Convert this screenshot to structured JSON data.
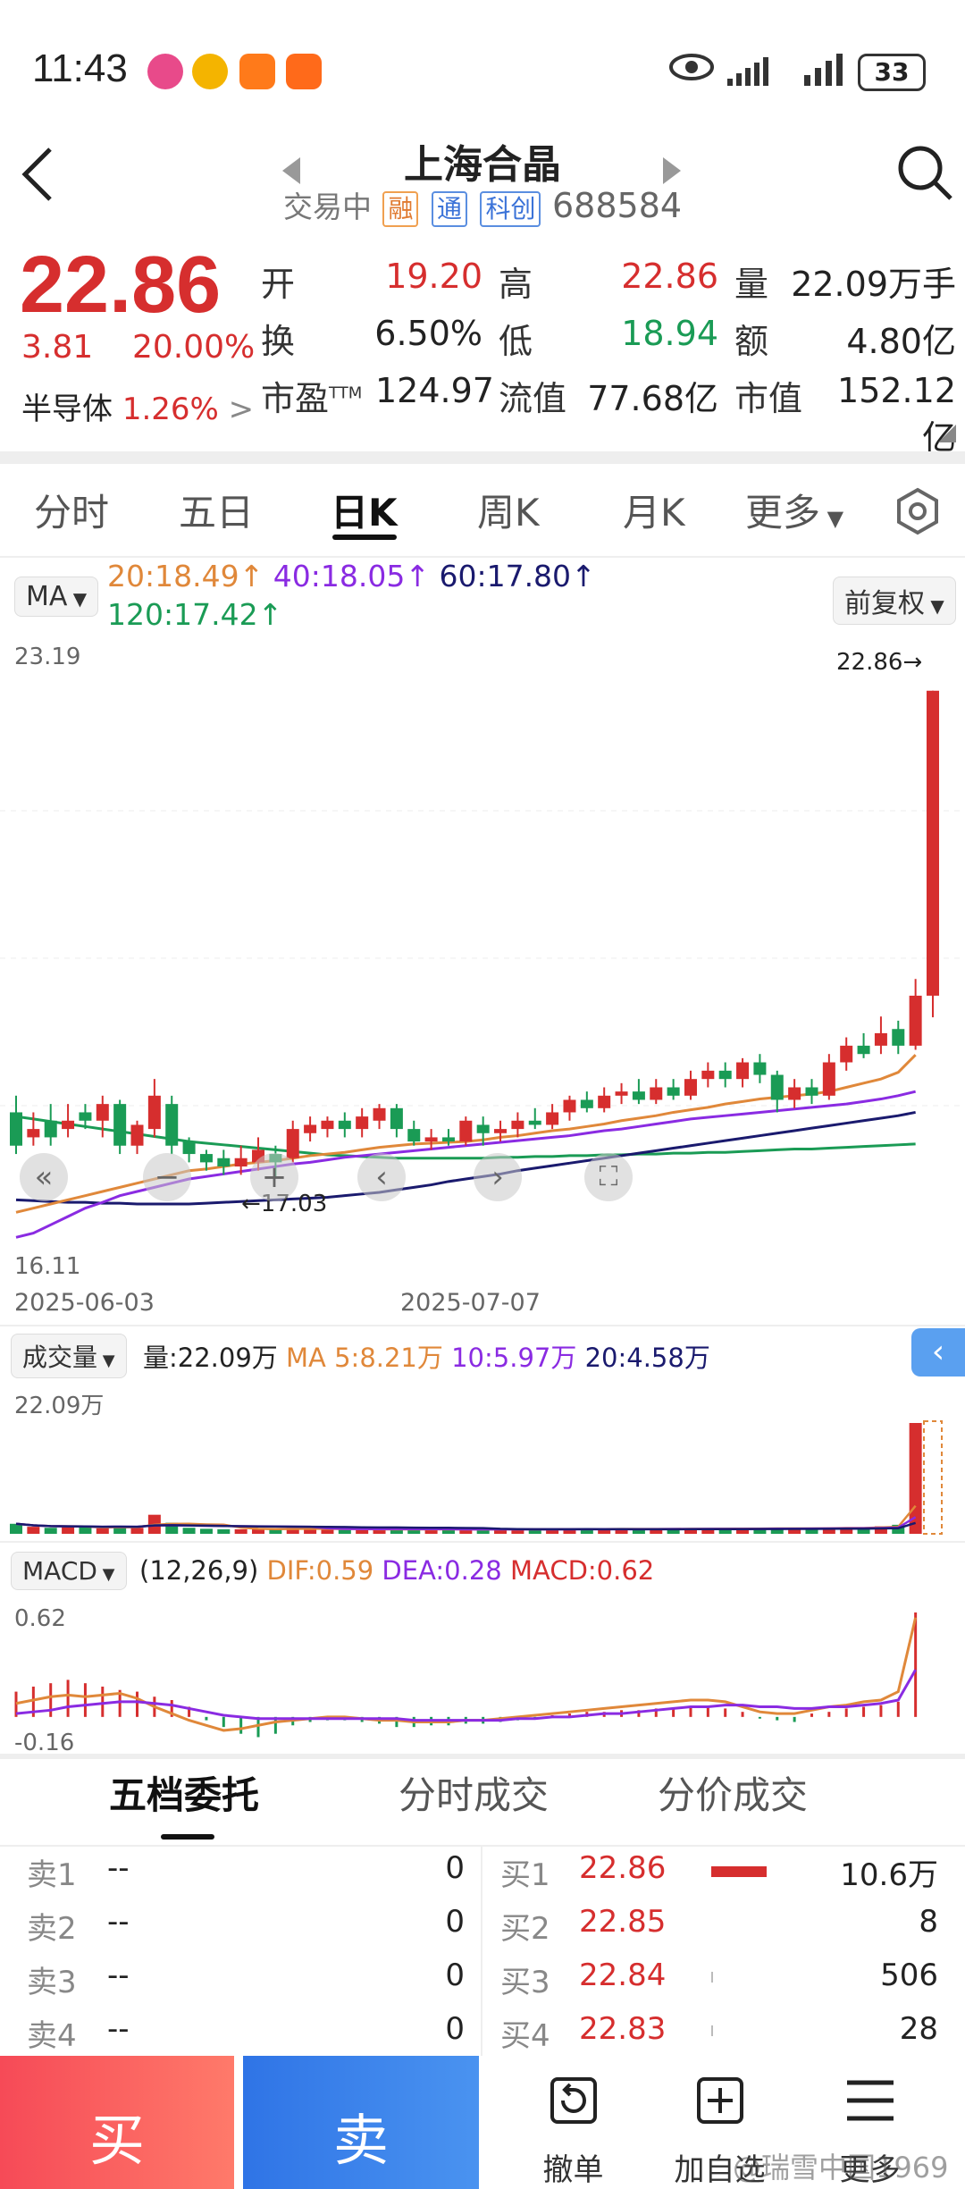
{
  "status": {
    "time": "11:43",
    "battery": "33"
  },
  "header": {
    "name": "上海合晶",
    "trade_status": "交易中",
    "tags": [
      "融",
      "通",
      "科创"
    ],
    "code": "688584"
  },
  "price": {
    "last": "22.86",
    "change": "3.81",
    "change_pct": "20.00%",
    "sector": "半导体",
    "sector_pct": "1.26%"
  },
  "quote": {
    "open_label": "开",
    "open": "19.20",
    "high_label": "高",
    "high": "22.86",
    "vol_label": "量",
    "vol": "22.09万手",
    "turnover_label": "换",
    "turnover": "6.50%",
    "low_label": "低",
    "low": "18.94",
    "amount_label": "额",
    "amount": "4.80亿",
    "pe_label": "市盈",
    "pe_sup": "TTM",
    "pe": "124.97",
    "float_label": "流值",
    "float_cap": "77.68亿",
    "mcap_label": "市值",
    "mcap": "152.12亿"
  },
  "tabs": [
    "分时",
    "五日",
    "日K",
    "周K",
    "月K",
    "更多"
  ],
  "ma": {
    "chip": "MA",
    "ma20": "20:18.49",
    "ma40": "40:18.05",
    "ma60": "60:17.80",
    "ma120": "120:17.42",
    "adjust": "前复权"
  },
  "kline": {
    "top_label": "23.19",
    "bottom_label": "16.11",
    "max_label": "22.86",
    "min_label": "17.03",
    "date_start": "2025-06-03",
    "date_mid": "2025-07-07"
  },
  "volume": {
    "chip": "成交量",
    "vol": "量:22.09万",
    "ma5": "MA 5:8.21万",
    "ma10": "10:5.97万",
    "ma20": "20:4.58万",
    "top_label": "22.09万"
  },
  "macd": {
    "chip": "MACD",
    "params": "(12,26,9)",
    "dif": "DIF:0.59",
    "dea": "DEA:0.28",
    "macd": "MACD:0.62",
    "top_label": "0.62",
    "bottom_label": "-0.16"
  },
  "bottom_tabs": [
    "五档委托",
    "分时成交",
    "分价成交"
  ],
  "sell_orders": [
    {
      "label": "卖1",
      "price": "--",
      "qty": "0"
    },
    {
      "label": "卖2",
      "price": "--",
      "qty": "0"
    },
    {
      "label": "卖3",
      "price": "--",
      "qty": "0"
    },
    {
      "label": "卖4",
      "price": "--",
      "qty": "0"
    }
  ],
  "buy_orders": [
    {
      "label": "买1",
      "price": "22.86",
      "qty": "10.6万"
    },
    {
      "label": "买2",
      "price": "22.85",
      "qty": "8"
    },
    {
      "label": "买3",
      "price": "22.84",
      "qty": "506"
    },
    {
      "label": "买4",
      "price": "22.83",
      "qty": "28"
    }
  ],
  "actions": {
    "buy": "买",
    "sell": "卖",
    "cancel": "撤单",
    "watch": "加自选",
    "more": "更多"
  },
  "watermark": "@瑞雪中国1969",
  "colors": {
    "up": "#d62e2e",
    "down": "#1a9b55",
    "ma20": "#e0883a",
    "ma40": "#8a2be2",
    "ma60": "#1a1a6e",
    "ma120": "#1a9b55"
  },
  "chart_data": {
    "type": "candlestick",
    "y_range": [
      16.11,
      23.19
    ],
    "candles": [
      {
        "o": 17.8,
        "c": 17.4,
        "h": 18.0,
        "l": 17.3
      },
      {
        "o": 17.5,
        "c": 17.6,
        "h": 17.8,
        "l": 17.4
      },
      {
        "o": 17.7,
        "c": 17.5,
        "h": 17.9,
        "l": 17.4
      },
      {
        "o": 17.6,
        "c": 17.7,
        "h": 17.9,
        "l": 17.5
      },
      {
        "o": 17.8,
        "c": 17.7,
        "h": 17.9,
        "l": 17.6
      },
      {
        "o": 17.7,
        "c": 17.9,
        "h": 18.0,
        "l": 17.5
      },
      {
        "o": 17.9,
        "c": 17.4,
        "h": 17.95,
        "l": 17.3
      },
      {
        "o": 17.4,
        "c": 17.65,
        "h": 17.7,
        "l": 17.3
      },
      {
        "o": 17.6,
        "c": 18.0,
        "h": 18.2,
        "l": 17.5
      },
      {
        "o": 17.9,
        "c": 17.4,
        "h": 18.0,
        "l": 17.3
      },
      {
        "o": 17.45,
        "c": 17.3,
        "h": 17.5,
        "l": 17.2
      },
      {
        "o": 17.3,
        "c": 17.2,
        "h": 17.35,
        "l": 17.1
      },
      {
        "o": 17.25,
        "c": 17.15,
        "h": 17.35,
        "l": 17.05
      },
      {
        "o": 17.15,
        "c": 17.25,
        "h": 17.4,
        "l": 17.05
      },
      {
        "o": 17.2,
        "c": 17.35,
        "h": 17.5,
        "l": 17.1
      },
      {
        "o": 17.3,
        "c": 17.2,
        "h": 17.4,
        "l": 17.03
      },
      {
        "o": 17.25,
        "c": 17.6,
        "h": 17.7,
        "l": 17.2
      },
      {
        "o": 17.55,
        "c": 17.65,
        "h": 17.75,
        "l": 17.45
      },
      {
        "o": 17.6,
        "c": 17.7,
        "h": 17.75,
        "l": 17.5
      },
      {
        "o": 17.7,
        "c": 17.6,
        "h": 17.8,
        "l": 17.5
      },
      {
        "o": 17.6,
        "c": 17.75,
        "h": 17.85,
        "l": 17.5
      },
      {
        "o": 17.7,
        "c": 17.85,
        "h": 17.9,
        "l": 17.6
      },
      {
        "o": 17.85,
        "c": 17.6,
        "h": 17.9,
        "l": 17.5
      },
      {
        "o": 17.6,
        "c": 17.45,
        "h": 17.7,
        "l": 17.4
      },
      {
        "o": 17.45,
        "c": 17.5,
        "h": 17.6,
        "l": 17.35
      },
      {
        "o": 17.5,
        "c": 17.45,
        "h": 17.6,
        "l": 17.4
      },
      {
        "o": 17.45,
        "c": 17.7,
        "h": 17.75,
        "l": 17.4
      },
      {
        "o": 17.65,
        "c": 17.55,
        "h": 17.75,
        "l": 17.4
      },
      {
        "o": 17.55,
        "c": 17.6,
        "h": 17.7,
        "l": 17.45
      },
      {
        "o": 17.6,
        "c": 17.7,
        "h": 17.8,
        "l": 17.5
      },
      {
        "o": 17.7,
        "c": 17.65,
        "h": 17.85,
        "l": 17.6
      },
      {
        "o": 17.65,
        "c": 17.8,
        "h": 17.9,
        "l": 17.6
      },
      {
        "o": 17.8,
        "c": 17.95,
        "h": 18.0,
        "l": 17.7
      },
      {
        "o": 17.95,
        "c": 17.85,
        "h": 18.05,
        "l": 17.8
      },
      {
        "o": 17.85,
        "c": 18.0,
        "h": 18.1,
        "l": 17.8
      },
      {
        "o": 18.0,
        "c": 18.05,
        "h": 18.15,
        "l": 17.9
      },
      {
        "o": 18.05,
        "c": 17.95,
        "h": 18.2,
        "l": 17.9
      },
      {
        "o": 17.95,
        "c": 18.1,
        "h": 18.2,
        "l": 17.9
      },
      {
        "o": 18.1,
        "c": 18.0,
        "h": 18.2,
        "l": 17.95
      },
      {
        "o": 18.0,
        "c": 18.2,
        "h": 18.3,
        "l": 17.95
      },
      {
        "o": 18.2,
        "c": 18.3,
        "h": 18.4,
        "l": 18.1
      },
      {
        "o": 18.3,
        "c": 18.2,
        "h": 18.4,
        "l": 18.1
      },
      {
        "o": 18.2,
        "c": 18.4,
        "h": 18.45,
        "l": 18.1
      },
      {
        "o": 18.4,
        "c": 18.25,
        "h": 18.5,
        "l": 18.15
      },
      {
        "o": 18.25,
        "c": 17.95,
        "h": 18.3,
        "l": 17.8
      },
      {
        "o": 17.95,
        "c": 18.1,
        "h": 18.2,
        "l": 17.85
      },
      {
        "o": 18.1,
        "c": 18.0,
        "h": 18.2,
        "l": 17.9
      },
      {
        "o": 18.0,
        "c": 18.4,
        "h": 18.5,
        "l": 17.95
      },
      {
        "o": 18.4,
        "c": 18.6,
        "h": 18.7,
        "l": 18.3
      },
      {
        "o": 18.6,
        "c": 18.5,
        "h": 18.75,
        "l": 18.45
      },
      {
        "o": 18.6,
        "c": 18.75,
        "h": 18.95,
        "l": 18.5
      },
      {
        "o": 18.8,
        "c": 18.6,
        "h": 18.9,
        "l": 18.5
      },
      {
        "o": 18.6,
        "c": 19.2,
        "h": 19.4,
        "l": 18.55
      },
      {
        "o": 19.2,
        "c": 22.86,
        "h": 22.86,
        "l": 18.94
      }
    ],
    "ma20_series": [
      16.6,
      16.65,
      16.7,
      16.75,
      16.8,
      16.85,
      16.9,
      16.95,
      17.0,
      17.05,
      17.1,
      17.12,
      17.15,
      17.18,
      17.2,
      17.22,
      17.25,
      17.28,
      17.3,
      17.32,
      17.35,
      17.38,
      17.4,
      17.42,
      17.43,
      17.44,
      17.45,
      17.47,
      17.5,
      17.52,
      17.55,
      17.58,
      17.6,
      17.63,
      17.66,
      17.7,
      17.73,
      17.76,
      17.8,
      17.83,
      17.86,
      17.9,
      17.93,
      17.96,
      17.98,
      18.0,
      18.02,
      18.05,
      18.1,
      18.15,
      18.2,
      18.28,
      18.49
    ],
    "ma40_series": [
      16.3,
      16.35,
      16.45,
      16.55,
      16.65,
      16.72,
      16.8,
      16.85,
      16.9,
      16.95,
      17.0,
      17.03,
      17.06,
      17.09,
      17.12,
      17.15,
      17.18,
      17.2,
      17.23,
      17.26,
      17.28,
      17.3,
      17.32,
      17.34,
      17.36,
      17.38,
      17.4,
      17.42,
      17.44,
      17.46,
      17.48,
      17.5,
      17.52,
      17.55,
      17.58,
      17.6,
      17.63,
      17.66,
      17.69,
      17.72,
      17.74,
      17.76,
      17.78,
      17.8,
      17.82,
      17.84,
      17.86,
      17.88,
      17.9,
      17.93,
      17.96,
      18.0,
      18.05
    ],
    "ma60_series": [
      16.75,
      16.74,
      16.73,
      16.72,
      16.72,
      16.71,
      16.71,
      16.7,
      16.7,
      16.7,
      16.7,
      16.71,
      16.72,
      16.73,
      16.74,
      16.75,
      16.76,
      16.77,
      16.78,
      16.8,
      16.82,
      16.84,
      16.87,
      16.9,
      16.93,
      16.97,
      17.0,
      17.03,
      17.06,
      17.1,
      17.13,
      17.16,
      17.19,
      17.22,
      17.25,
      17.28,
      17.31,
      17.34,
      17.37,
      17.4,
      17.43,
      17.46,
      17.49,
      17.52,
      17.55,
      17.58,
      17.61,
      17.64,
      17.67,
      17.7,
      17.73,
      17.76,
      17.8
    ],
    "ma120_series": [
      17.75,
      17.72,
      17.69,
      17.66,
      17.63,
      17.6,
      17.57,
      17.54,
      17.51,
      17.48,
      17.45,
      17.43,
      17.41,
      17.39,
      17.37,
      17.35,
      17.33,
      17.31,
      17.29,
      17.28,
      17.27,
      17.26,
      17.25,
      17.25,
      17.25,
      17.25,
      17.25,
      17.25,
      17.26,
      17.26,
      17.27,
      17.27,
      17.28,
      17.28,
      17.29,
      17.29,
      17.3,
      17.3,
      17.31,
      17.31,
      17.32,
      17.32,
      17.33,
      17.34,
      17.35,
      17.36,
      17.36,
      17.37,
      17.38,
      17.39,
      17.4,
      17.41,
      17.42
    ],
    "volumes": [
      2.0,
      1.4,
      1.2,
      1.4,
      1.3,
      1.1,
      1.6,
      1.2,
      3.8,
      2.2,
      1.2,
      1.0,
      0.9,
      0.9,
      1.0,
      0.9,
      1.2,
      1.0,
      0.9,
      0.8,
      0.9,
      0.9,
      1.0,
      0.8,
      0.9,
      0.9,
      0.9,
      0.8,
      0.9,
      0.9,
      0.9,
      0.9,
      1.0,
      1.0,
      0.9,
      1.0,
      0.9,
      1.0,
      1.0,
      1.0,
      1.0,
      1.0,
      1.1,
      1.0,
      1.2,
      1.0,
      1.1,
      1.2,
      1.3,
      1.2,
      1.5,
      1.8,
      22.09
    ],
    "macd_bars": [
      0.15,
      0.18,
      0.2,
      0.22,
      0.2,
      0.18,
      0.16,
      0.15,
      0.12,
      0.1,
      0.06,
      -0.02,
      -0.06,
      -0.1,
      -0.12,
      -0.1,
      -0.05,
      -0.03,
      -0.02,
      -0.02,
      -0.03,
      -0.04,
      -0.06,
      -0.06,
      -0.05,
      -0.05,
      -0.04,
      -0.04,
      -0.03,
      -0.02,
      -0.01,
      0.01,
      0.02,
      0.03,
      0.03,
      0.04,
      0.04,
      0.05,
      0.05,
      0.06,
      0.06,
      0.05,
      0.03,
      -0.01,
      -0.02,
      -0.03,
      0.02,
      0.03,
      0.05,
      0.06,
      0.07,
      0.09,
      0.62
    ],
    "dif_series": [
      0.08,
      0.1,
      0.12,
      0.13,
      0.12,
      0.13,
      0.14,
      0.11,
      0.06,
      0.02,
      -0.02,
      -0.05,
      -0.08,
      -0.07,
      -0.05,
      -0.03,
      -0.02,
      -0.01,
      0.0,
      0.0,
      -0.01,
      -0.02,
      -0.02,
      -0.03,
      -0.03,
      -0.03,
      -0.02,
      -0.02,
      -0.01,
      0.0,
      0.01,
      0.02,
      0.03,
      0.04,
      0.05,
      0.06,
      0.07,
      0.08,
      0.09,
      0.1,
      0.1,
      0.09,
      0.06,
      0.03,
      0.02,
      0.02,
      0.04,
      0.06,
      0.07,
      0.09,
      0.1,
      0.15,
      0.59
    ],
    "dea_series": [
      0.02,
      0.03,
      0.04,
      0.06,
      0.07,
      0.08,
      0.09,
      0.09,
      0.08,
      0.07,
      0.05,
      0.03,
      0.01,
      0.0,
      -0.01,
      -0.01,
      -0.01,
      -0.01,
      -0.01,
      -0.01,
      -0.01,
      -0.01,
      -0.01,
      -0.02,
      -0.02,
      -0.02,
      -0.02,
      -0.02,
      -0.02,
      -0.01,
      -0.01,
      0.0,
      0.0,
      0.01,
      0.02,
      0.02,
      0.03,
      0.04,
      0.05,
      0.06,
      0.06,
      0.07,
      0.07,
      0.06,
      0.06,
      0.05,
      0.05,
      0.06,
      0.06,
      0.07,
      0.08,
      0.1,
      0.28
    ]
  }
}
